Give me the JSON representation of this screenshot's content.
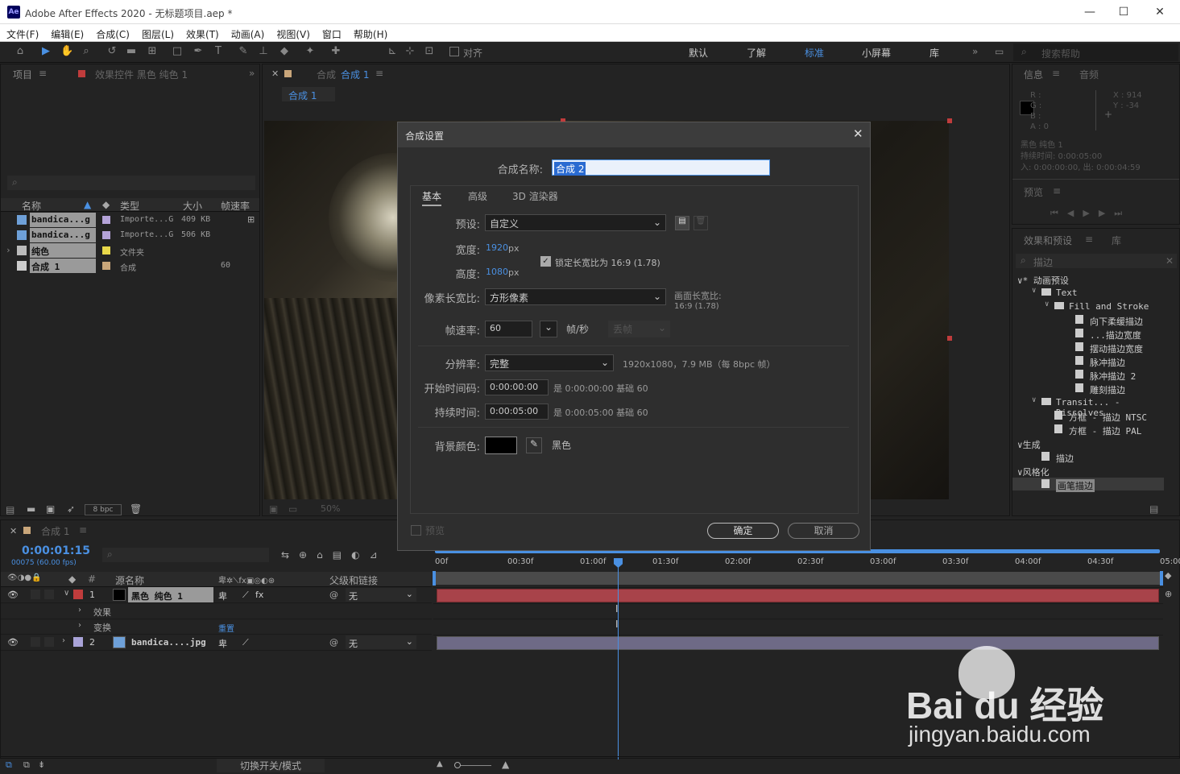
{
  "window": {
    "title": "Adobe After Effects 2020 - 无标题项目.aep *",
    "logo": "Ae"
  },
  "menu": [
    "文件(F)",
    "编辑(E)",
    "合成(C)",
    "图层(L)",
    "效果(T)",
    "动画(A)",
    "视图(V)",
    "窗口",
    "帮助(H)"
  ],
  "toolbar": {
    "align_label": "对齐",
    "workspaces": [
      "默认",
      "了解",
      "标准",
      "小屏幕",
      "库"
    ],
    "active_workspace": "标准",
    "search_help": "搜索帮助"
  },
  "project": {
    "tab": "项目",
    "effects_tab": "效果控件 黑色 纯色 1",
    "headers": [
      "名称",
      "类型",
      "大小",
      "帧速率"
    ],
    "items": [
      {
        "name": "bandica...g",
        "type": "Importe...G",
        "size": "409 KB",
        "fps": "",
        "color": "#b4a3d8"
      },
      {
        "name": "bandica...g",
        "type": "Importe...G",
        "size": "506 KB",
        "fps": "",
        "color": "#b4a3d8"
      },
      {
        "name": "纯色",
        "type": "文件夹",
        "size": "",
        "fps": "",
        "color": "#e8d84a"
      },
      {
        "name": "合成 1",
        "type": "合成",
        "size": "",
        "fps": "60",
        "color": "#c9a67a"
      }
    ],
    "bpc": "8 bpc"
  },
  "comp": {
    "tab": "合成",
    "tab_name": "合成 1",
    "breadcrumb": "合成 1",
    "zoom": "50%"
  },
  "dialog": {
    "title": "合成设置",
    "name_label": "合成名称:",
    "name_value": "合成 2",
    "tabs": [
      "基本",
      "高级",
      "3D 渲染器"
    ],
    "preset_label": "预设:",
    "preset_value": "自定义",
    "width_label": "宽度:",
    "width_value": "1920",
    "width_unit": "px",
    "height_label": "高度:",
    "height_value": "1080",
    "height_unit": "px",
    "lock_label": "锁定长宽比为 16:9 (1.78)",
    "par_label": "像素长宽比:",
    "par_value": "方形像素",
    "frame_aspect_label": "画面长宽比:",
    "frame_aspect_value": "16:9 (1.78)",
    "fps_label": "帧速率:",
    "fps_value": "60",
    "fps_unit": "帧/秒",
    "drop_frame": "丢帧",
    "res_label": "分辨率:",
    "res_value": "完整",
    "res_info": "1920x1080，7.9 MB（每 8bpc 帧）",
    "start_label": "开始时间码:",
    "start_value": "0:00:00:00",
    "start_info": "是 0:00:00:00  基础 60",
    "dur_label": "持续时间:",
    "dur_value": "0:00:05:00",
    "dur_info": "是 0:00:05:00  基础 60",
    "bg_label": "背景颜色:",
    "bg_name": "黑色",
    "bg_color": "#000000",
    "preview_label": "预览",
    "ok": "确定",
    "cancel": "取消"
  },
  "info": {
    "tab": "信息",
    "audio_tab": "音频",
    "r": "R :",
    "g": "G :",
    "b": "B :",
    "a": "A : 0",
    "x": "X : 914",
    "y": "Y : -34",
    "layer": "黑色 纯色 1",
    "duration": "持续时间: 0:00:05:00",
    "inout": "入: 0:00:00:00, 出: 0:00:04:59"
  },
  "preview": {
    "tab": "预览"
  },
  "effects": {
    "tab": "效果和预设",
    "lib_tab": "库",
    "search": "描边",
    "tree": [
      {
        "t": "∨* 动画预设",
        "lvl": 0,
        "ic": ""
      },
      {
        "t": "Text",
        "lvl": 1,
        "ic": "folder"
      },
      {
        "t": "Fill and Stroke",
        "lvl": 2,
        "ic": "folder"
      },
      {
        "t": "向下柔缓描边",
        "lvl": 3,
        "ic": "fx"
      },
      {
        "t": "...描边宽度",
        "lvl": 3,
        "ic": "fx"
      },
      {
        "t": "摆动描边宽度",
        "lvl": 3,
        "ic": "fx"
      },
      {
        "t": "脉冲描边",
        "lvl": 3,
        "ic": "fx"
      },
      {
        "t": "脉冲描边 2",
        "lvl": 3,
        "ic": "fx"
      },
      {
        "t": "雕刻描边",
        "lvl": 3,
        "ic": "fx"
      },
      {
        "t": "Transit... - Dissolves",
        "lvl": 1,
        "ic": "folder"
      },
      {
        "t": "方框 - 描边 NTSC",
        "lvl": 2,
        "ic": "fx"
      },
      {
        "t": "方框 - 描边 PAL",
        "lvl": 2,
        "ic": "fx"
      },
      {
        "t": "∨生成",
        "lvl": 0,
        "ic": ""
      },
      {
        "t": "描边",
        "lvl": 1,
        "ic": "fx"
      },
      {
        "t": "∨风格化",
        "lvl": 0,
        "ic": ""
      },
      {
        "t": "画笔描边",
        "lvl": 1,
        "ic": "fx"
      }
    ]
  },
  "timeline": {
    "tab": "合成 1",
    "timecode": "0:00:01:15",
    "frame_info": "00075 (60.00 fps)",
    "headers": {
      "source": "源名称",
      "parent": "父级和链接"
    },
    "ruler": [
      "00f",
      "00:30f",
      "01:00f",
      "01:30f",
      "02:00f",
      "02:30f",
      "03:00f",
      "03:30f",
      "04:00f",
      "04:30f",
      "05:00"
    ],
    "layers": [
      {
        "num": "1",
        "name": "黑色 纯色 1",
        "parent": "无",
        "color": "#c03c3c"
      },
      {
        "num": "2",
        "name": "bandica....jpg",
        "parent": "无",
        "color": "#a9a3d8"
      }
    ],
    "sub": [
      "效果",
      "变换"
    ],
    "reset": "重置",
    "toggle": "切换开关/模式"
  },
  "watermark": {
    "brand": "Bai du 经验",
    "url": "jingyan.baidu.com"
  }
}
